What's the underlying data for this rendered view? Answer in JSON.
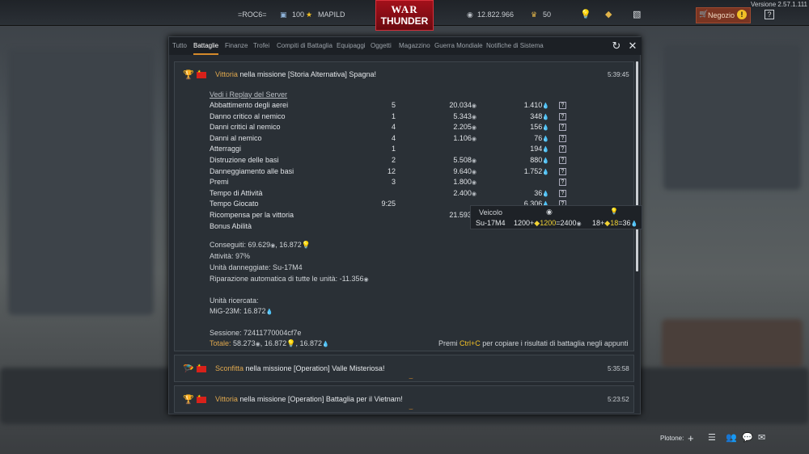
{
  "topbar": {
    "nick": "=ROC6=",
    "level": "100",
    "clan": "MAPILD",
    "logo_top": "WAR",
    "logo_bottom": "THUNDER",
    "silver": "12.822.966",
    "eagles": "50",
    "shop": "Negozio",
    "version": "Versione 2.57.1.111"
  },
  "tabs": [
    "Tutto",
    "Battaglie",
    "Finanze",
    "Trofei",
    "Compiti di Battaglia",
    "Equipaggi",
    "Oggetti",
    "Magazzino",
    "Guerra Mondiale",
    "Notifiche di Sistema"
  ],
  "entry1": {
    "status": "Vittoria",
    "text": " nella missione [Storia Alternativa] Spagna!",
    "time": "5:39:45",
    "replay": "Vedi i Replay del Server",
    "rows": [
      {
        "label": "Abbattimento degli aerei",
        "n": "5",
        "sl": "20.034",
        "rp": "1.410"
      },
      {
        "label": "Danno critico al nemico",
        "n": "1",
        "sl": "5.343",
        "rp": "348"
      },
      {
        "label": "Danni critici al nemico",
        "n": "4",
        "sl": "2.205",
        "rp": "156"
      },
      {
        "label": "Danni al nemico",
        "n": "4",
        "sl": "1.106",
        "rp": "76"
      },
      {
        "label": "Atterraggi",
        "n": "1",
        "sl": "",
        "rp": "194"
      },
      {
        "label": "Distruzione delle basi",
        "n": "2",
        "sl": "5.508",
        "rp": "880"
      },
      {
        "label": "Danneggiamento alle basi",
        "n": "12",
        "sl": "9.640",
        "rp": "1.752"
      },
      {
        "label": "Premi",
        "n": "3",
        "sl": "1.800",
        "rp": ""
      },
      {
        "label": "Tempo di Attività",
        "n": "",
        "sl": "2.400",
        "rp": "36"
      },
      {
        "label": "Tempo Giocato",
        "n": "9:25",
        "sl": "",
        "rp": "6.306"
      },
      {
        "label": "Ricompensa per la vittoria",
        "n": "",
        "sl": "21.593",
        "rp": ""
      },
      {
        "label": "Bonus Abilità",
        "n": "",
        "sl": "",
        "rp": ""
      }
    ],
    "earned_label": "Conseguiti:",
    "earned_sl": "69.629",
    "earned_rp": "16.872",
    "activity": "Attività: 97%",
    "damaged": "Unità danneggiate: Su-17M4",
    "repair_label": "Riparazione automatica di tutte le unità:",
    "repair_value": "-11.356",
    "researched_label": "Unità ricercata:",
    "researched_unit": "MiG-23M:",
    "researched_rp": "16.872",
    "session": "Sessione: 72411770004cf7e",
    "total_label": "Totale:",
    "total_sl": "58.273",
    "total_rp1": "16.872",
    "total_rp2": "16.872",
    "copy_pre": "Premi ",
    "copy_key": "Ctrl+C",
    "copy_post": " per copiare i risultati di battaglia negli appunti"
  },
  "tooltip": {
    "col": "Veicolo",
    "unit": "Su-17M4",
    "sl_a": "1200",
    "sl_b": "1200",
    "sl_c": "2400",
    "rp_a": "18",
    "rp_b": "18",
    "rp_c": "36"
  },
  "entry2": {
    "status": "Sconfitta",
    "text": " nella missione [Operation] Valle Misteriosa!",
    "time": "5:35:58"
  },
  "entry3": {
    "status": "Vittoria",
    "text": " nella missione [Operation] Battaglia per il Vietnam!",
    "time": "5:23:52"
  },
  "bottom": {
    "squad": "Plotone:"
  },
  "colors": {
    "accent": "#d58a2a",
    "victory": "#e0a84e",
    "panel": "#252a30"
  }
}
